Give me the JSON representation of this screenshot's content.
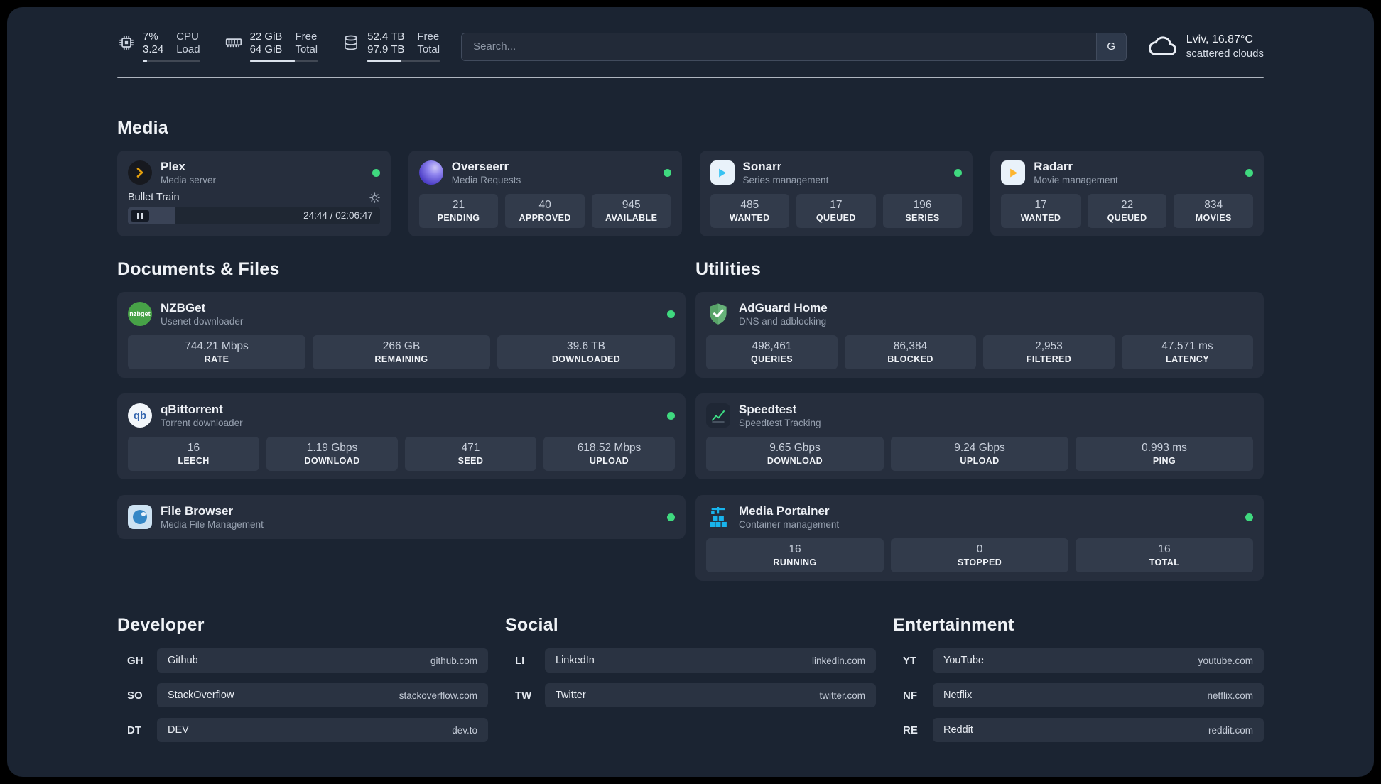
{
  "topbar": {
    "cpu": {
      "percent": 7,
      "value_top": "7%",
      "label_top": "CPU",
      "value_bottom": "3.24",
      "label_bottom": "Load"
    },
    "memory": {
      "percent": 66,
      "value_top": "22 GiB",
      "label_top": "Free",
      "value_bottom": "64 GiB",
      "label_bottom": "Total"
    },
    "disk": {
      "percent": 47,
      "value_top": "52.4 TB",
      "label_top": "Free",
      "value_bottom": "97.9 TB",
      "label_bottom": "Total"
    },
    "search": {
      "placeholder": "Search...",
      "engine_button": "G"
    },
    "weather": {
      "location": "Lviv, 16.87°C",
      "condition": "scattered clouds"
    }
  },
  "section_titles": {
    "media": "Media",
    "documents": "Documents & Files",
    "utilities": "Utilities",
    "developer": "Developer",
    "social": "Social",
    "entertainment": "Entertainment"
  },
  "apps": {
    "plex": {
      "name": "Plex",
      "desc": "Media server",
      "player": {
        "title": "Bullet Train",
        "time": "24:44 / 02:06:47",
        "progress": 19
      }
    },
    "overseerr": {
      "name": "Overseerr",
      "desc": "Media Requests",
      "stats": [
        {
          "value": "21",
          "label": "PENDING"
        },
        {
          "value": "40",
          "label": "APPROVED"
        },
        {
          "value": "945",
          "label": "AVAILABLE"
        }
      ]
    },
    "sonarr": {
      "name": "Sonarr",
      "desc": "Series management",
      "stats": [
        {
          "value": "485",
          "label": "WANTED"
        },
        {
          "value": "17",
          "label": "QUEUED"
        },
        {
          "value": "196",
          "label": "SERIES"
        }
      ]
    },
    "radarr": {
      "name": "Radarr",
      "desc": "Movie management",
      "stats": [
        {
          "value": "17",
          "label": "WANTED"
        },
        {
          "value": "22",
          "label": "QUEUED"
        },
        {
          "value": "834",
          "label": "MOVIES"
        }
      ]
    },
    "nzbget": {
      "name": "NZBGet",
      "desc": "Usenet downloader",
      "stats": [
        {
          "value": "744.21 Mbps",
          "label": "RATE"
        },
        {
          "value": "266 GB",
          "label": "REMAINING"
        },
        {
          "value": "39.6 TB",
          "label": "DOWNLOADED"
        }
      ]
    },
    "qbittorrent": {
      "name": "qBittorrent",
      "desc": "Torrent downloader",
      "stats": [
        {
          "value": "16",
          "label": "LEECH"
        },
        {
          "value": "1.19 Gbps",
          "label": "DOWNLOAD"
        },
        {
          "value": "471",
          "label": "SEED"
        },
        {
          "value": "618.52 Mbps",
          "label": "UPLOAD"
        }
      ]
    },
    "filebrowser": {
      "name": "File Browser",
      "desc": "Media File Management"
    },
    "adguard": {
      "name": "AdGuard Home",
      "desc": "DNS and adblocking",
      "stats": [
        {
          "value": "498,461",
          "label": "QUERIES"
        },
        {
          "value": "86,384",
          "label": "BLOCKED"
        },
        {
          "value": "2,953",
          "label": "FILTERED"
        },
        {
          "value": "47.571 ms",
          "label": "LATENCY"
        }
      ]
    },
    "speedtest": {
      "name": "Speedtest",
      "desc": "Speedtest Tracking",
      "stats": [
        {
          "value": "9.65 Gbps",
          "label": "DOWNLOAD"
        },
        {
          "value": "9.24 Gbps",
          "label": "UPLOAD"
        },
        {
          "value": "0.993 ms",
          "label": "PING"
        }
      ]
    },
    "portainer": {
      "name": "Media Portainer",
      "desc": "Container management",
      "stats": [
        {
          "value": "16",
          "label": "RUNNING"
        },
        {
          "value": "0",
          "label": "STOPPED"
        },
        {
          "value": "16",
          "label": "TOTAL"
        }
      ]
    }
  },
  "bookmarks": {
    "developer": [
      {
        "abbr": "GH",
        "name": "Github",
        "url": "github.com"
      },
      {
        "abbr": "SO",
        "name": "StackOverflow",
        "url": "stackoverflow.com"
      },
      {
        "abbr": "DT",
        "name": "DEV",
        "url": "dev.to"
      }
    ],
    "social": [
      {
        "abbr": "LI",
        "name": "LinkedIn",
        "url": "linkedin.com"
      },
      {
        "abbr": "TW",
        "name": "Twitter",
        "url": "twitter.com"
      }
    ],
    "entertainment": [
      {
        "abbr": "YT",
        "name": "YouTube",
        "url": "youtube.com"
      },
      {
        "abbr": "NF",
        "name": "Netflix",
        "url": "netflix.com"
      },
      {
        "abbr": "RE",
        "name": "Reddit",
        "url": "reddit.com"
      }
    ]
  },
  "colors": {
    "status_online": "#3fd97f",
    "accent_green": "#3ddc84",
    "portainer_blue": "#18b4ec",
    "plex_amber": "#e5a00d"
  }
}
